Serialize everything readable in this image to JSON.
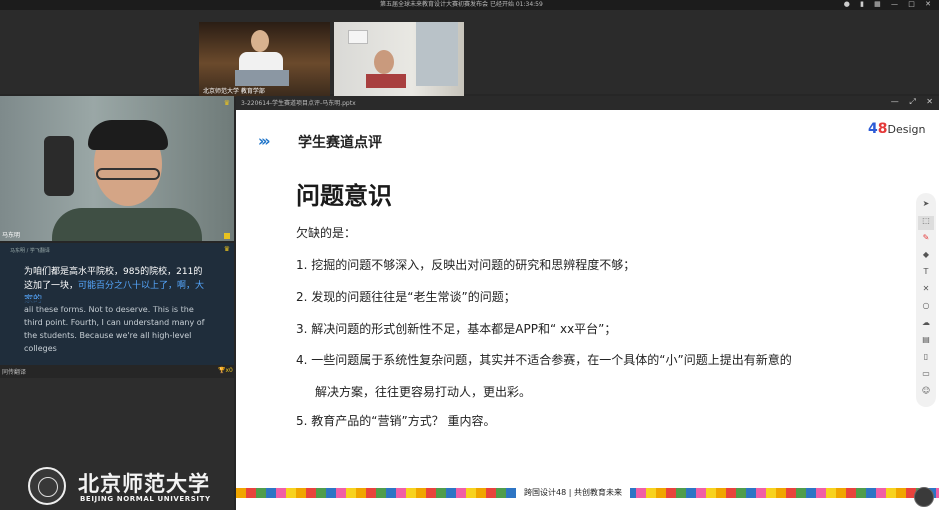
{
  "meeting": {
    "title": "第五届全球未来教育设计大赛初赛发布会",
    "elapsed": "已经开始 01:34:59"
  },
  "gallery": {
    "tile_1_label": "北京师范大学 教育学部",
    "tile_2_label": ""
  },
  "speaker": {
    "name": "马东明"
  },
  "captions": {
    "header": "马东明 / 学飞翻译",
    "chinese_line": "为咱们都是高水平院校，985的院校，211的这加了一块，",
    "chinese_highlight": "可能百分之八十以上了，啊，大家的",
    "english": "all these forms. Not to deserve. This is the third point. Fourth, I can understand many of the students. Because we're all high-level colleges",
    "panel_label": "同传翻译",
    "mic_count": "x0"
  },
  "university": {
    "name_cn": "北京师范大学",
    "name_en": "BEIJING NORMAL UNIVERSITY"
  },
  "slide_window": {
    "filename": "3-220614-学生赛道项目点评-马东明.pptx"
  },
  "slide": {
    "section_title": "学生赛道点评",
    "logo_num_a": "4",
    "logo_num_b": "8",
    "logo_text": "Design",
    "heading": "问题意识",
    "intro": "欠缺的是：",
    "items": [
      "1.  挖掘的问题不够深入，反映出对问题的研究和思辨程度不够；",
      "2.  发现的问题往往是“老生常谈”的问题；",
      "3.  解决问题的形式创新性不足，基本都是APP和“ xx平台”；",
      "4.  一些问题属于系统性复杂问题，其实并不适合参赛，在一个具体的“小”问题上提出有新意的",
      "解决方案，往往更容易打动人，更出彩。",
      "5.  教育产品的“营销”方式？ 重内容。"
    ],
    "footer": "跨国设计48  |  共创教育未来"
  },
  "toolbar": {
    "icons": [
      "cursor-icon",
      "select-icon",
      "pen-icon",
      "eraser-icon",
      "text-icon",
      "close-icon",
      "shape-icon",
      "cloud-icon",
      "save-icon",
      "doc-icon",
      "chat-icon",
      "user-icon"
    ]
  }
}
